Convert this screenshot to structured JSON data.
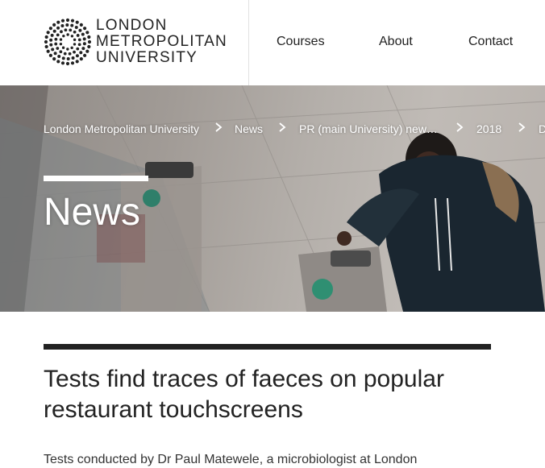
{
  "header": {
    "logo": {
      "lines": [
        "LONDON",
        "METROPOLITAN",
        "UNIVERSITY"
      ]
    },
    "nav": [
      {
        "label": "Courses"
      },
      {
        "label": "About"
      },
      {
        "label": "Contact"
      }
    ]
  },
  "hero": {
    "breadcrumb": [
      {
        "label": "London Metropolitan University"
      },
      {
        "label": "News"
      },
      {
        "label": "PR (main University) new…"
      },
      {
        "label": "2018"
      },
      {
        "label": "D"
      }
    ],
    "separator": "›",
    "title": "News"
  },
  "article": {
    "title": "Tests find traces of faeces on popular restaurant touchscreens",
    "intro": "Tests conducted by Dr Paul Matewele, a microbiologist at London"
  },
  "colors": {
    "text_dark": "#222222",
    "hero_text": "#ffffff",
    "divider": "#e2e2e2"
  },
  "icons": {
    "logo_mark": "dotted-circle-logo-icon",
    "breadcrumb_separator": "chevron-right-icon"
  }
}
